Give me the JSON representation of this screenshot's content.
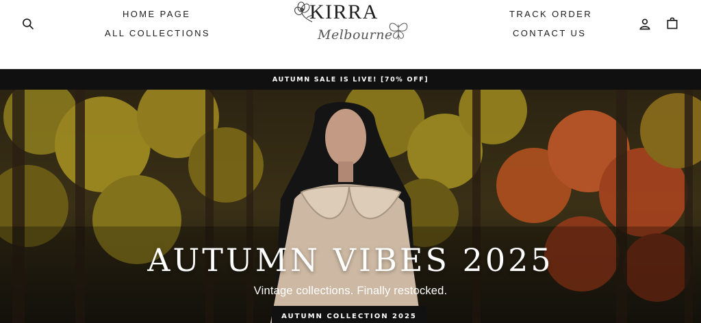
{
  "header": {
    "nav_left": [
      "HOME PAGE",
      "ALL COLLECTIONS"
    ],
    "nav_right": [
      "TRACK ORDER",
      "CONTACT US"
    ],
    "logo": {
      "name": "KIRRA",
      "location": "Melbourne"
    },
    "icons": {
      "search": "search-icon",
      "account": "user-icon",
      "cart": "bag-icon"
    }
  },
  "announcement": {
    "text": "AUTUMN SALE IS LIVE! [70% OFF]"
  },
  "hero": {
    "title": "AUTUMN VIBES 2025",
    "subtitle": "Vintage collections. Finally restocked.",
    "cta": "AUTUMN COLLECTION 2025"
  },
  "colors": {
    "announcement_bg": "#101010",
    "text_dark": "#1a1a1a",
    "cta_bg": "#111111"
  }
}
